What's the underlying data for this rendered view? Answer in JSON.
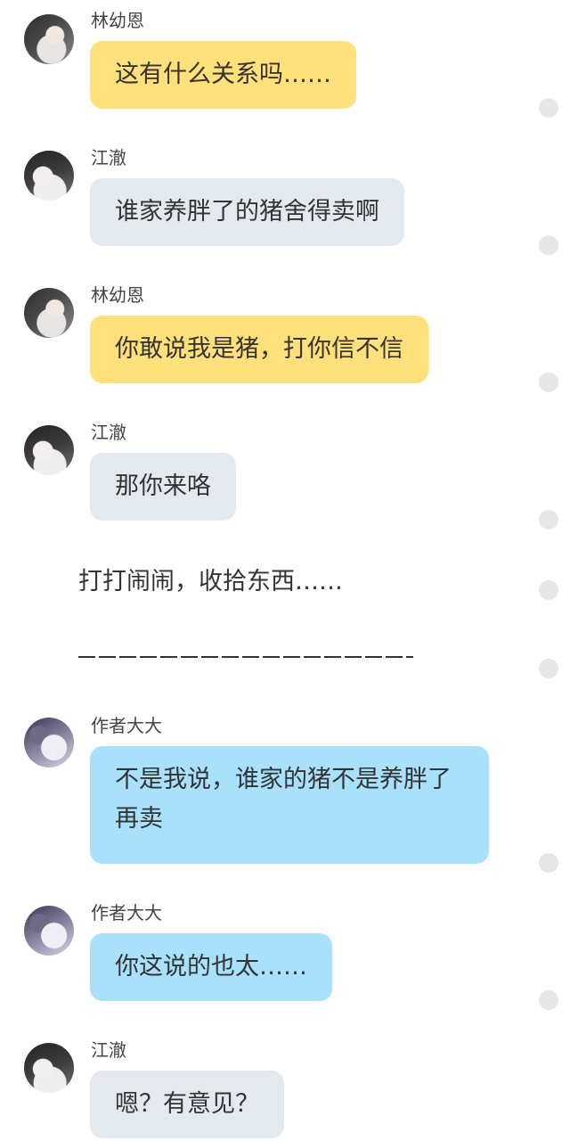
{
  "messages": [
    {
      "sender": "林幼恩",
      "text": "这有什么关系吗……"
    },
    {
      "sender": "江澈",
      "text": "谁家养胖了的猪舍得卖啊"
    },
    {
      "sender": "林幼恩",
      "text": "你敢说我是猪，打你信不信"
    },
    {
      "sender": "江澈",
      "text": "那你来咯"
    },
    {
      "sender": "作者大大",
      "text": "不是我说，谁家的猪不是养胖了再卖"
    },
    {
      "sender": "作者大大",
      "text": "你这说的也太……"
    },
    {
      "sender": "江澈",
      "text": "嗯？有意见？"
    }
  ],
  "narration": {
    "line": "打打闹闹，收拾东西……",
    "divider": "———————————————"
  },
  "colors": {
    "lin_bubble": "#ffe07a",
    "jiang_bubble": "#e4e8ef",
    "author_bubble": "#a9e0fb"
  }
}
